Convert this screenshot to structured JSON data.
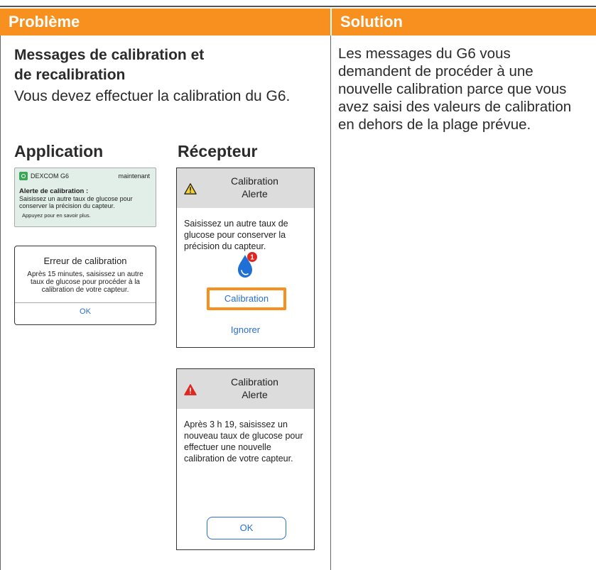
{
  "headers": {
    "problem": "Problème",
    "solution": "Solution"
  },
  "problem": {
    "title_line1": "Messages de calibration et",
    "title_line2": "de recalibration",
    "body": "Vous devez effectuer la calibration du G6.",
    "app_heading": "Application",
    "receiver_heading": "Récepteur"
  },
  "app_notification": {
    "app_name": "DEXCOM G6",
    "time": "maintenant",
    "title": "Alerte de calibration :",
    "body": "Saisissez un autre taux de glucose pour conserver la précision du capteur.",
    "more": "Appuyez pour en savoir plus.",
    "icon": "dexcom-app-icon"
  },
  "app_dialog": {
    "title": "Erreur de calibration",
    "body": "Après 15 minutes, saisissez un autre taux de glucose pour procéder à la calibration de votre capteur.",
    "ok": "OK"
  },
  "receiver_alert_1": {
    "title_line1": "Calibration",
    "title_line2": "Alerte",
    "text": "Saisissez un autre taux de glucose pour conserver la précision du capteur.",
    "calibrate_button": "Calibration",
    "ignore_button": "Ignorer",
    "icon": "warning-triangle-yellow-icon",
    "badge": "1"
  },
  "receiver_alert_2": {
    "title_line1": "Calibration",
    "title_line2": "Alerte",
    "text": "Après 3 h 19, saisissez un nouveau taux de glucose pour effectuer une nouvelle calibration de votre capteur.",
    "ok": "OK",
    "icon": "warning-triangle-red-icon"
  },
  "solution": {
    "text": "Les messages du G6 vous demandent de procéder à une nouvelle calibration parce que vous avez saisi des valeurs de calibration en dehors de la plage prévue."
  },
  "colors": {
    "header_orange": "#f7901e",
    "link_blue": "#2a6fd1",
    "notification_bg": "#e2efe9",
    "receiver_header_gray": "#dcdcdc"
  }
}
